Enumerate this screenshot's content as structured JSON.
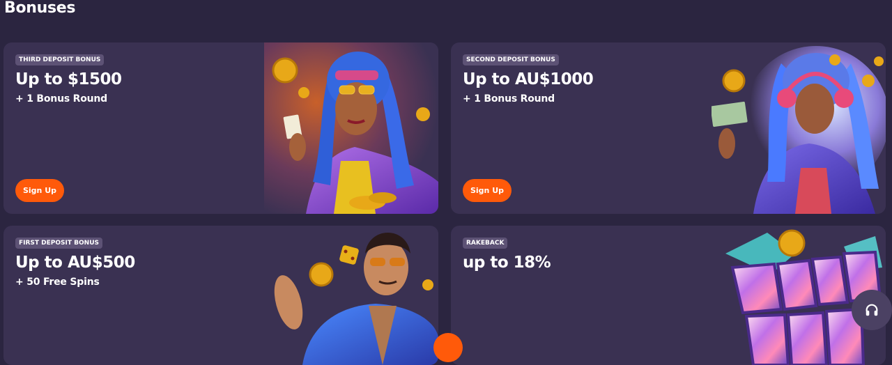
{
  "page": {
    "title": "Bonuses"
  },
  "cards": [
    {
      "badge": "THIRD DEPOSIT BONUS",
      "headline": "Up to $1500",
      "subline": "+ 1 Bonus Round",
      "cta": "Sign Up",
      "art": "woman-blue-dreadlocks-with-cards-and-coins"
    },
    {
      "badge": "SECOND DEPOSIT BONUS",
      "headline": "Up to AU$1000",
      "subline": "+ 1 Bonus Round",
      "cta": "Sign Up",
      "art": "woman-with-headphones-and-cash"
    },
    {
      "badge": "FIRST DEPOSIT BONUS",
      "headline": "Up to AU$500",
      "subline": "+ 50 Free Spins",
      "art": "man-in-sunglasses-with-dice-and-coins"
    },
    {
      "badge": "RAKEBACK",
      "headline": "up to 18%",
      "subline": "",
      "art": "rakeback-logo-with-coin"
    }
  ],
  "support": {
    "icon": "headphones-icon"
  },
  "colors": {
    "background": "#2b2540",
    "card": "#3a3152",
    "badge": "#5d5275",
    "accent": "#ff5a0a"
  }
}
